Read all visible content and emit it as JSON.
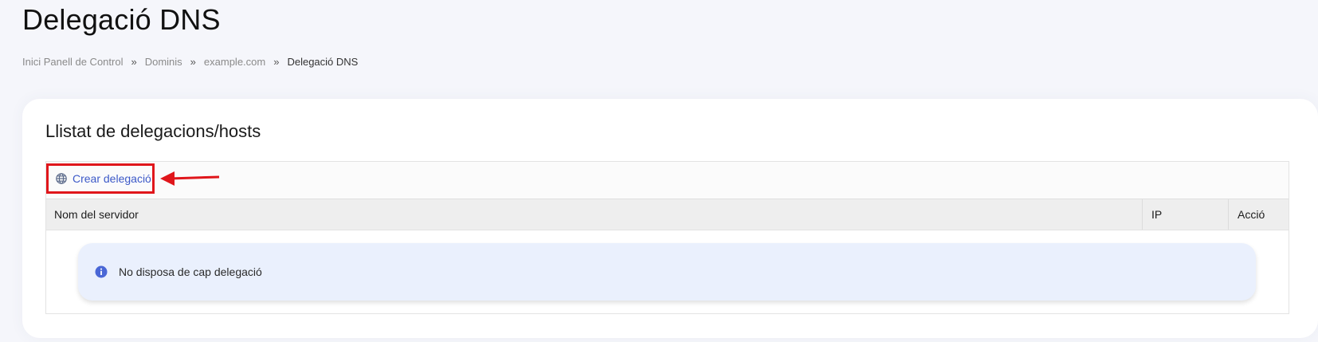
{
  "page": {
    "title": "Delegació DNS"
  },
  "breadcrumb": {
    "items": [
      {
        "label": "Inici Panell de Control"
      },
      {
        "label": "Dominis"
      },
      {
        "label": "example.com"
      },
      {
        "label": "Delegació DNS"
      }
    ],
    "separator": "»"
  },
  "card": {
    "title": "Llistat de delegacions/hosts"
  },
  "toolbar": {
    "create_label": "Crear delegació",
    "create_icon": "globe-icon",
    "highlight_color": "#e0161b"
  },
  "table": {
    "columns": [
      {
        "label": "Nom del servidor"
      },
      {
        "label": "IP"
      },
      {
        "label": "Acció"
      }
    ],
    "rows": []
  },
  "empty_state": {
    "icon": "info-icon",
    "message": "No disposa de cap delegació"
  },
  "colors": {
    "accent": "#3c59c8",
    "alert_bg": "#eaf0fd",
    "info_icon": "#4a67d6"
  }
}
